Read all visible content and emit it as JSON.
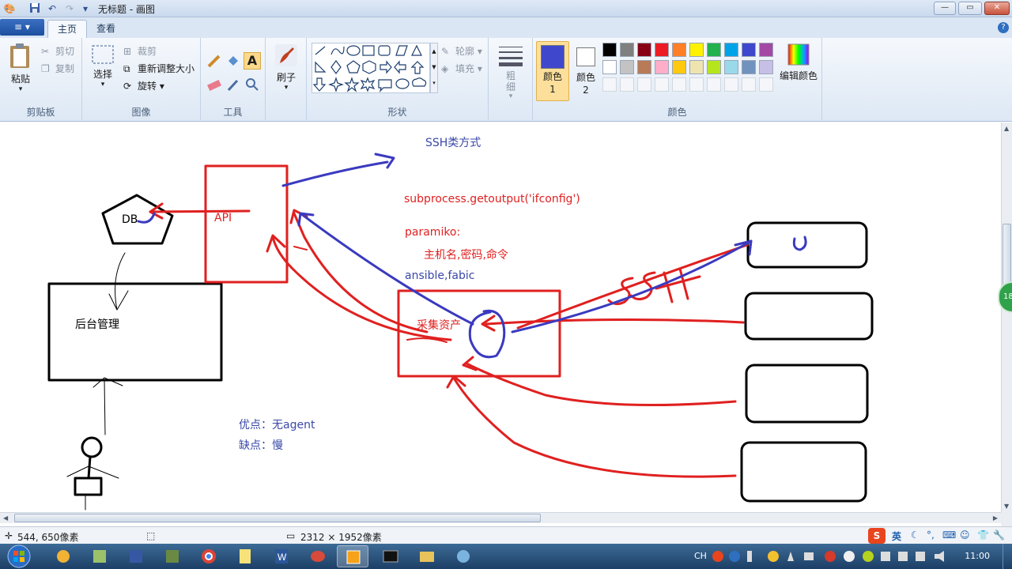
{
  "window": {
    "title": "无标题 - 画图",
    "controls": {
      "minimize": "—",
      "maximize": "▭",
      "close": "✕"
    }
  },
  "ribbon": {
    "file_menu": "≡ ▾",
    "tabs": [
      {
        "label": "主页"
      },
      {
        "label": "查看"
      }
    ],
    "help": "?",
    "clipboard": {
      "paste": "粘贴",
      "cut": "剪切",
      "copy": "复制",
      "label": "剪贴板"
    },
    "image": {
      "select": "选择",
      "crop": "裁剪",
      "resize": "重新调整大小",
      "rotate": "旋转",
      "label": "图像"
    },
    "tools": {
      "label": "工具"
    },
    "brushes": {
      "label": "刷子"
    },
    "shapes": {
      "outline": "轮廓",
      "fill": "填充",
      "label": "形状"
    },
    "size": {
      "label": "粗细"
    },
    "colors": {
      "color1": "颜色 1",
      "color2": "颜色 2",
      "edit": "编辑颜色",
      "label": "颜色",
      "color1_value": "#3f48cc",
      "color2_value": "#ffffff",
      "palette_row1": [
        "#000000",
        "#7f7f7f",
        "#880015",
        "#ed1c24",
        "#ff7f27",
        "#fff200",
        "#22b14c",
        "#00a2e8",
        "#3f48cc",
        "#a349a4"
      ],
      "palette_row2": [
        "#ffffff",
        "#c3c3c3",
        "#b97a57",
        "#ffaec9",
        "#ffc90e",
        "#efe4b0",
        "#b5e61d",
        "#99d9ea",
        "#7092be",
        "#c8bfe7"
      ]
    }
  },
  "drawing": {
    "ssh_title": "SSH类方式",
    "subprocess": "subprocess.getoutput('ifconfig')",
    "paramiko": "paramiko:",
    "paramiko_args": "主机名,密码,命令",
    "ansible": "ansible,fabic",
    "db": "DB",
    "api": "API",
    "backend": "后台管理",
    "collect": "采集资产",
    "ssh_scribble": "SSH",
    "pros": "优点：无agent",
    "cons": "缺点：慢"
  },
  "status": {
    "cursor_pos": "544, 650像素",
    "image_size": "2312 × 1952像素"
  },
  "taskbar": {
    "lang": "CH",
    "clock": "11:00",
    "ime_label": "英",
    "badge": "18"
  }
}
